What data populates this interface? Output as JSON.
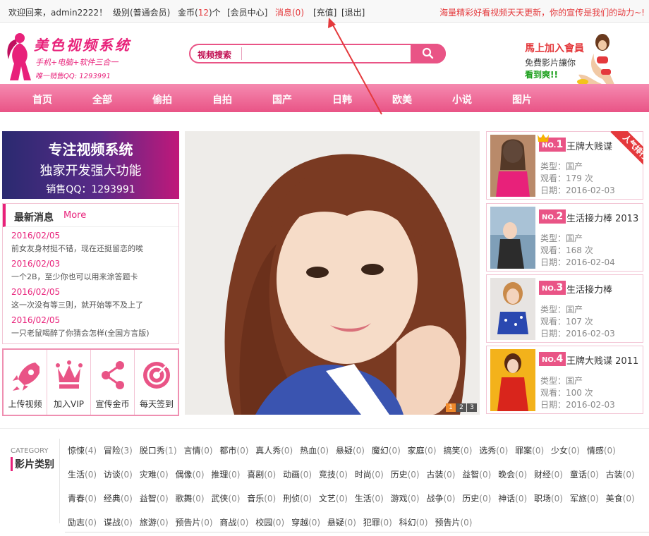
{
  "topbar": {
    "welcome": "欢迎回来，admin2222！",
    "level": "级别(普通会员)",
    "gold_prefix": "金币(",
    "gold_count": "12",
    "gold_suffix": ")个",
    "member_center": "[会员中心]",
    "messages": "消息(0)",
    "recharge": "[充值]",
    "logout": "[退出]",
    "slogan": "海量精彩好看视频天天更新，你的宣传是我们的动力~!"
  },
  "logo": {
    "title": "美色视频系统",
    "subtitle": "手机+电脑+软件三合一",
    "qq": "唯一销售QQ: 1293991"
  },
  "search": {
    "tag": "视频搜索",
    "placeholder": ""
  },
  "join": {
    "line1": "馬上加入會員",
    "line2": "免費影片讓你",
    "line3": "看到爽!!"
  },
  "nav": {
    "items": [
      "首页",
      "全部",
      "偷拍",
      "自拍",
      "国产",
      "日韩",
      "欧美",
      "小说",
      "图片"
    ]
  },
  "banner": {
    "line1": "专注视频系统",
    "line2": "独家开发强大功能",
    "line3": "销售QQ：1293991"
  },
  "news": {
    "title": "最新消息",
    "more": "More",
    "items": [
      {
        "date": "2016/02/05",
        "text": "前女友身材挺不错，现在还挺留恋的唉"
      },
      {
        "date": "2016/02/03",
        "text": "一个2B，至少你也可以用来涂答题卡"
      },
      {
        "date": "2016/02/05",
        "text": "这一次没有等三则，就开始等不及上了"
      },
      {
        "date": "2016/02/05",
        "text": "一只老鼠喝醉了你猜会怎样(全国方言版)"
      }
    ]
  },
  "actions": {
    "upload": "上传视频",
    "vip": "加入VIP",
    "promote": "宣传金币",
    "checkin": "每天签到"
  },
  "slider": {
    "dots": [
      "1",
      "2",
      "3"
    ]
  },
  "ranking": {
    "ribbon": "人气排行",
    "type_label": "类型：",
    "views_label": "观看：",
    "date_label": "日期：",
    "items": [
      {
        "no": "1",
        "name": "王牌大贱谍",
        "type": "国产",
        "views": "179 次",
        "date": "2016-02-03"
      },
      {
        "no": "2",
        "name": "生活接力棒 2013",
        "type": "国产",
        "views": "168 次",
        "date": "2016-02-04"
      },
      {
        "no": "3",
        "name": "生活接力棒",
        "type": "国产",
        "views": "107 次",
        "date": "2016-02-03"
      },
      {
        "no": "4",
        "name": "王牌大贱谍 2011",
        "type": "国产",
        "views": "100 次",
        "date": "2016-02-03"
      }
    ]
  },
  "category": {
    "en": "CATEGORY",
    "cn": "影片类别",
    "items": [
      {
        "n": "惊悚",
        "c": "(4)"
      },
      {
        "n": "冒险",
        "c": "(3)"
      },
      {
        "n": "脱口秀",
        "c": "(1)"
      },
      {
        "n": "言情",
        "c": "(0)"
      },
      {
        "n": "都市",
        "c": "(0)"
      },
      {
        "n": "真人秀",
        "c": "(0)"
      },
      {
        "n": "热血",
        "c": "(0)"
      },
      {
        "n": "悬疑",
        "c": "(0)"
      },
      {
        "n": "魔幻",
        "c": "(0)"
      },
      {
        "n": "家庭",
        "c": "(0)"
      },
      {
        "n": "搞笑",
        "c": "(0)"
      },
      {
        "n": "选秀",
        "c": "(0)"
      },
      {
        "n": "罪案",
        "c": "(0)"
      },
      {
        "n": "少女",
        "c": "(0)"
      },
      {
        "n": "情感",
        "c": "(0)"
      },
      {
        "n": "生活",
        "c": "(0)"
      },
      {
        "n": "访谈",
        "c": "(0)"
      },
      {
        "n": "灾难",
        "c": "(0)"
      },
      {
        "n": "偶像",
        "c": "(0)"
      },
      {
        "n": "推理",
        "c": "(0)"
      },
      {
        "n": "喜剧",
        "c": "(0)"
      },
      {
        "n": "动画",
        "c": "(0)"
      },
      {
        "n": "竞技",
        "c": "(0)"
      },
      {
        "n": "时尚",
        "c": "(0)"
      },
      {
        "n": "历史",
        "c": "(0)"
      },
      {
        "n": "古装",
        "c": "(0)"
      },
      {
        "n": "益智",
        "c": "(0)"
      },
      {
        "n": "晚会",
        "c": "(0)"
      },
      {
        "n": "财经",
        "c": "(0)"
      },
      {
        "n": "童话",
        "c": "(0)"
      },
      {
        "n": "古装",
        "c": "(0)"
      },
      {
        "n": "青春",
        "c": "(0)"
      },
      {
        "n": "经典",
        "c": "(0)"
      },
      {
        "n": "益智",
        "c": "(0)"
      },
      {
        "n": "歌舞",
        "c": "(0)"
      },
      {
        "n": "武侠",
        "c": "(0)"
      },
      {
        "n": "音乐",
        "c": "(0)"
      },
      {
        "n": "刑侦",
        "c": "(0)"
      },
      {
        "n": "文艺",
        "c": "(0)"
      },
      {
        "n": "生活",
        "c": "(0)"
      },
      {
        "n": "游戏",
        "c": "(0)"
      },
      {
        "n": "战争",
        "c": "(0)"
      },
      {
        "n": "历史",
        "c": "(0)"
      },
      {
        "n": "神话",
        "c": "(0)"
      },
      {
        "n": "职场",
        "c": "(0)"
      },
      {
        "n": "军旅",
        "c": "(0)"
      },
      {
        "n": "美食",
        "c": "(0)"
      },
      {
        "n": "励志",
        "c": "(0)"
      },
      {
        "n": "谍战",
        "c": "(0)"
      },
      {
        "n": "旅游",
        "c": "(0)"
      },
      {
        "n": "预告片",
        "c": "(0)"
      },
      {
        "n": "商战",
        "c": "(0)"
      },
      {
        "n": "校园",
        "c": "(0)"
      },
      {
        "n": "穿越",
        "c": "(0)"
      },
      {
        "n": "悬疑",
        "c": "(0)"
      },
      {
        "n": "犯罪",
        "c": "(0)"
      },
      {
        "n": "科幻",
        "c": "(0)"
      },
      {
        "n": "预告片",
        "c": "(0)"
      }
    ]
  },
  "colors": {
    "brand_pink": "#e95486",
    "accent_red": "#e4393c",
    "gold_count": "#e4393c"
  }
}
